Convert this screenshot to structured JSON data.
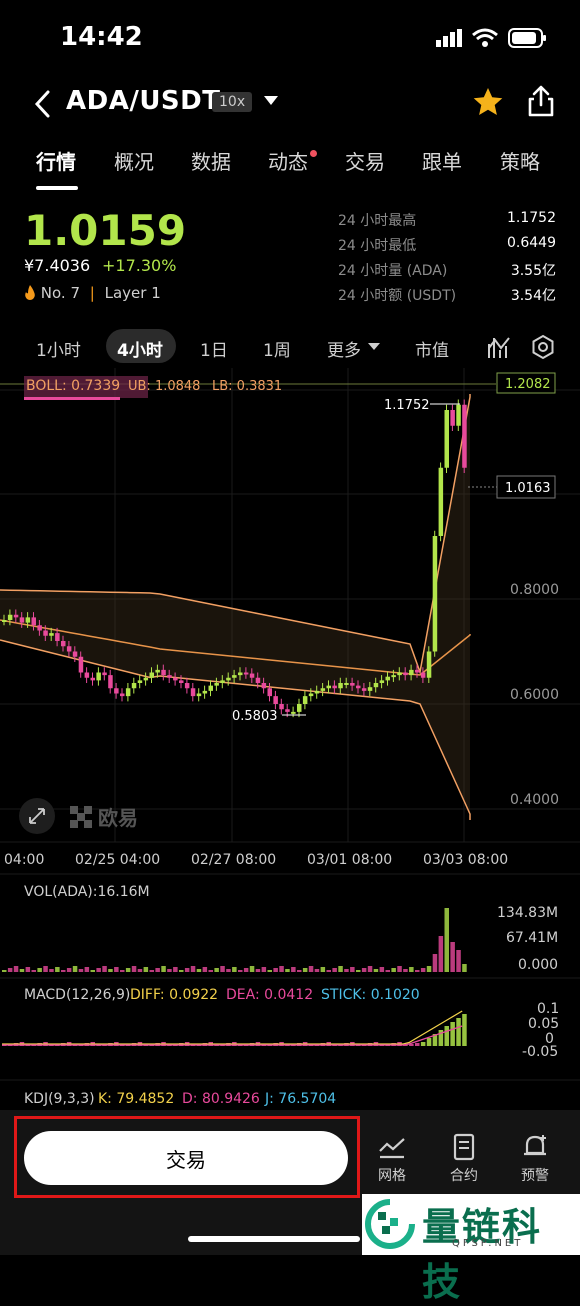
{
  "status": {
    "time": "14:42"
  },
  "header": {
    "pair": "ADA/USDT",
    "leverage": "10x"
  },
  "tabs": [
    {
      "label": "行情"
    },
    {
      "label": "概况"
    },
    {
      "label": "数据"
    },
    {
      "label": "动态"
    },
    {
      "label": "交易"
    },
    {
      "label": "跟单"
    },
    {
      "label": "策略"
    }
  ],
  "ticker": {
    "price": "1.0159",
    "cny": "¥7.4036",
    "change": "+17.30%",
    "rank": "No. 7",
    "sep": "|",
    "layer": "Layer 1",
    "stats": [
      {
        "label": "24 小时最高",
        "value": "1.1752"
      },
      {
        "label": "24 小时最低",
        "value": "0.6449"
      },
      {
        "label": "24 小时量 (ADA)",
        "value": "3.55亿"
      },
      {
        "label": "24 小时额 (USDT)",
        "value": "3.54亿"
      }
    ]
  },
  "timeframes": [
    {
      "label": "1小时"
    },
    {
      "label": "4小时"
    },
    {
      "label": "1日"
    },
    {
      "label": "1周"
    },
    {
      "label": "更多"
    },
    {
      "label": "市值"
    }
  ],
  "indicators": {
    "boll": "BOLL: 0.7339",
    "ub": "UB: 1.0848",
    "lb": "LB: 0.3831",
    "vol": "VOL(ADA):16.16M",
    "macd_name": "MACD(12,26,9)",
    "diff": "DIFF: 0.0922",
    "dea": "DEA: 0.0412",
    "stick": "STICK: 0.1020",
    "kdj_name": "KDJ(9,3,3)",
    "k": "K: 79.4852",
    "d": "D: 80.9426",
    "j": "J: 76.5704"
  },
  "chart_data": {
    "type": "candlestick",
    "price_axis": [
      "1.2082",
      "0.8000",
      "0.6000",
      "0.4000"
    ],
    "current_price_tag": "1.0163",
    "high_marker": "1.1752",
    "low_marker": "0.5803",
    "date_labels": [
      "04:00",
      "02/25 04:00",
      "02/27 08:00",
      "03/01 08:00",
      "03/03 08:00"
    ],
    "volume_axis": [
      "134.83M",
      "67.41M",
      "0.000"
    ],
    "macd_axis": [
      "0.1",
      "0.05",
      "0",
      "-0.05"
    ],
    "watermark": "欧易",
    "colors": {
      "up": "#b2e54b",
      "down": "#e84a9c",
      "boll": "#f2a063",
      "mid": "#e8944a"
    }
  },
  "bottom": {
    "trade_label": "交易",
    "items": [
      {
        "label": "网格"
      },
      {
        "label": "合约"
      },
      {
        "label": "预警"
      }
    ]
  },
  "watermark": {
    "text": "量链科技",
    "sub": "QFSP.NET"
  }
}
